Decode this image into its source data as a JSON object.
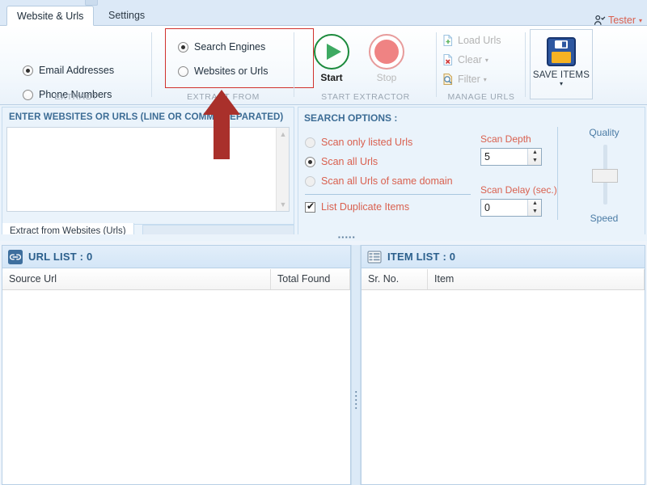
{
  "window": {
    "tabs": [
      {
        "label": "Website & Urls",
        "active": true
      },
      {
        "label": "Settings",
        "active": false
      }
    ],
    "user": {
      "name": "Tester",
      "icon": "user-check-icon",
      "caret": "▾",
      "color": "#d9604f"
    }
  },
  "ribbon": {
    "groups": [
      {
        "name": "extract",
        "label": "EXTRACT",
        "options": [
          {
            "label": "Email Addresses",
            "selected": true
          },
          {
            "label": "Phone Numbers",
            "selected": false
          }
        ]
      },
      {
        "name": "extract-from",
        "label": "EXTRACT FROM",
        "highlighted": true,
        "highlight_color": "#d0312d",
        "options": [
          {
            "label": "Search Engines",
            "selected": true
          },
          {
            "label": "Websites or Urls",
            "selected": false
          }
        ]
      },
      {
        "name": "start-extractor",
        "label": "START EXTRACTOR",
        "buttons": [
          {
            "label": "Start",
            "icon": "play-circle-icon",
            "enabled": true,
            "color": "#1c8a3c"
          },
          {
            "label": "Stop",
            "icon": "stop-circle-icon",
            "enabled": false,
            "color": "#ef8383"
          }
        ]
      },
      {
        "name": "manage-urls",
        "label": "MANAGE URLS",
        "commands": [
          {
            "label": "Load Urls",
            "icon": "file-add-icon",
            "caret": "",
            "enabled": false
          },
          {
            "label": "Clear",
            "icon": "file-delete-icon",
            "caret": "▾",
            "enabled": false
          },
          {
            "label": "Filter",
            "icon": "file-search-icon",
            "caret": "▾",
            "enabled": false
          }
        ]
      },
      {
        "name": "save-items",
        "label": "",
        "button": {
          "label": "SAVE ITEMS",
          "icon": "floppy-disk-icon",
          "caret": "▾"
        }
      }
    ]
  },
  "url_entry": {
    "title": "ENTER WEBSITES OR URLS (LINE OR COMMA SEPARATED)",
    "value": "",
    "placeholder": "",
    "scroll_up_icon": "chevron-up-icon",
    "scroll_down_icon": "chevron-down-icon",
    "subtab": "Extract from Websites (Urls)"
  },
  "search_options": {
    "title": "SEARCH OPTIONS :",
    "scope": [
      {
        "label": "Scan only listed Urls",
        "selected": false,
        "enabled": false
      },
      {
        "label": "Scan all Urls",
        "selected": true,
        "enabled": true
      },
      {
        "label": "Scan all Urls of same domain",
        "selected": false,
        "enabled": false
      }
    ],
    "duplicates": {
      "label": "List Duplicate Items",
      "checked": true
    },
    "scan_depth": {
      "label": "Scan Depth",
      "value": "5"
    },
    "scan_delay": {
      "label": "Scan Delay (sec.)",
      "value": "0"
    },
    "slider": {
      "top_label": "Quality",
      "bottom_label": "Speed",
      "position": "middle"
    }
  },
  "url_list": {
    "icon": "link-icon",
    "title": "URL LIST : 0",
    "count": 0,
    "columns": [
      "Source Url",
      "Total Found"
    ],
    "rows": []
  },
  "item_list": {
    "icon": "table-icon",
    "title": "ITEM LIST : 0",
    "count": 0,
    "columns": [
      "Sr. No.",
      "Item"
    ],
    "rows": []
  },
  "annotation": {
    "arrow": "up-arrow-annotation",
    "color": "#b52b27"
  }
}
